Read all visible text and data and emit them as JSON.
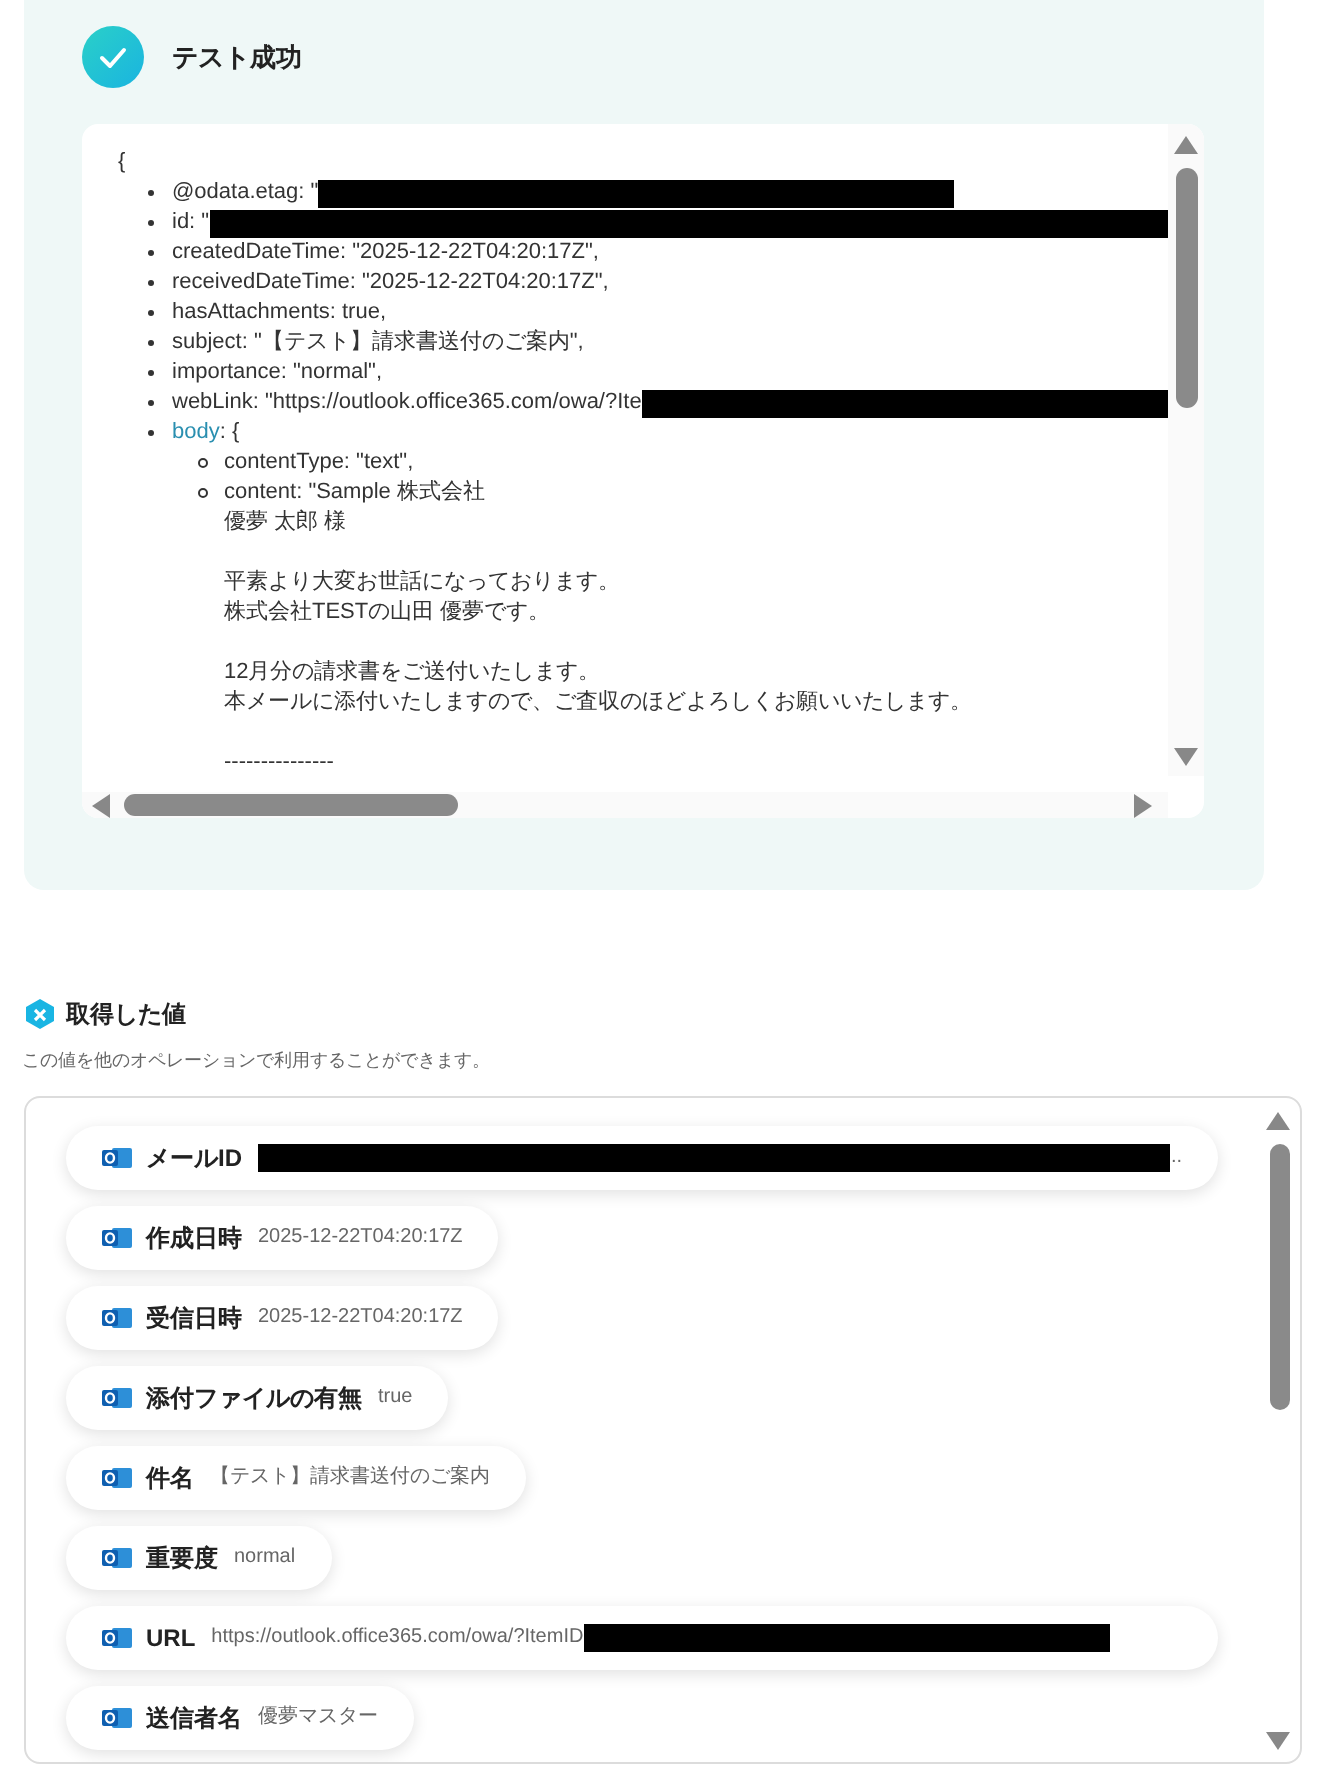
{
  "test_result": {
    "title": "テスト成功",
    "json_view": {
      "open_brace": "{",
      "entries": [
        {
          "text": "@odata.etag: \"",
          "redacted_after": true
        },
        {
          "text": "id: \"",
          "redacted_after": true
        },
        {
          "text": "createdDateTime: \"2025-12-22T04:20:17Z\","
        },
        {
          "text": "receivedDateTime: \"2025-12-22T04:20:17Z\","
        },
        {
          "text": "hasAttachments: true,"
        },
        {
          "text": "subject: \"【テスト】請求書送付のご案内\","
        },
        {
          "text": "importance: \"normal\","
        },
        {
          "text": "webLink: \"https://outlook.office365.com/owa/?Ite",
          "redacted_after": true
        },
        {
          "text": "body",
          "suffix": ": {",
          "children": [
            {
              "paragraphs": [
                [
                  "contentType: \"text\","
                ]
              ]
            },
            {
              "paragraphs": [
                [
                  "content: \"Sample 株式会社",
                  "優夢 太郎 様"
                ],
                [
                  "平素より大変お世話になっております。",
                  "株式会社TESTの山田 優夢です。"
                ],
                [
                  "12月分の請求書をご送付いたします。",
                  "本メールに添付いたしますので、ご査収のほどよろしくお願いいたします。"
                ],
                [
                  "---------------"
                ]
              ]
            }
          ]
        }
      ]
    }
  },
  "retrieved_values": {
    "title": "取得した値",
    "description": "この値を他のオペレーションで利用することができます。",
    "items": [
      {
        "label": "メールID",
        "value": "..",
        "redacted_before": true
      },
      {
        "label": "作成日時",
        "value": "2025-12-22T04:20:17Z"
      },
      {
        "label": "受信日時",
        "value": "2025-12-22T04:20:17Z"
      },
      {
        "label": "添付ファイルの有無",
        "value": "true"
      },
      {
        "label": "件名",
        "value": "【テスト】請求書送付のご案内"
      },
      {
        "label": "重要度",
        "value": "normal"
      },
      {
        "label": "URL",
        "value": "https://outlook.office365.com/owa/?ItemID",
        "redacted_after": true
      },
      {
        "label": "送信者名",
        "value": "優夢マスター"
      }
    ]
  }
}
